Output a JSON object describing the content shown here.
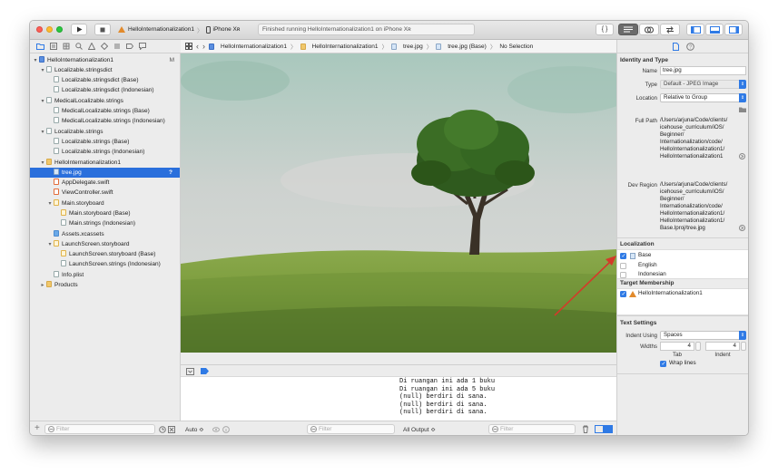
{
  "toolbar": {
    "scheme": "HelloInternationalization1",
    "device": "iPhone Xʀ",
    "status": "Finished running HelloInternationalization1 on iPhone Xʀ",
    "code_snippet_label": "{ }"
  },
  "navigator": {
    "items": [
      {
        "label": "HelloInternationalization1",
        "badge": "M"
      },
      {
        "label": "Localizable.stringsdict"
      },
      {
        "label": "Localizable.stringsdict (Base)"
      },
      {
        "label": "Localizable.stringsdict (Indonesian)"
      },
      {
        "label": "MedicalLocalizable.strings"
      },
      {
        "label": "MedicalLocalizable.strings (Base)"
      },
      {
        "label": "MedicalLocalizable.strings (Indonesian)"
      },
      {
        "label": "Localizable.strings"
      },
      {
        "label": "Localizable.strings (Base)"
      },
      {
        "label": "Localizable.strings (Indonesian)"
      },
      {
        "label": "HelloInternationalization1"
      },
      {
        "label": "tree.jpg",
        "badge": "?"
      },
      {
        "label": "AppDelegate.swift"
      },
      {
        "label": "ViewController.swift"
      },
      {
        "label": "Main.storyboard"
      },
      {
        "label": "Main.storyboard (Base)"
      },
      {
        "label": "Main.strings (Indonesian)"
      },
      {
        "label": "Assets.xcassets"
      },
      {
        "label": "LaunchScreen.storyboard"
      },
      {
        "label": "LaunchScreen.storyboard (Base)"
      },
      {
        "label": "LaunchScreen.strings (Indonesian)"
      },
      {
        "label": "Info.plist"
      },
      {
        "label": "Products"
      }
    ],
    "filter_placeholder": "Filter"
  },
  "jumpbar": {
    "crumbs": [
      "HelloInternationalization1",
      "HelloInternationalization1",
      "tree.jpg",
      "tree.jpg (Base)",
      "No Selection"
    ]
  },
  "console": {
    "lines": [
      "Di ruangan ini ada 1 buku",
      "Di ruangan ini ada 5 buku",
      "(null) berdiri di sana.",
      "(null) berdiri di sana.",
      "(null) berdiri di sana."
    ],
    "auto_label": "Auto ≎",
    "filter_placeholder": "Filter",
    "output_label": "All Output ≎",
    "filter2_placeholder": "Filter"
  },
  "inspector": {
    "identity_title": "Identity and Type",
    "name_label": "Name",
    "name_value": "tree.jpg",
    "type_label": "Type",
    "type_value": "Default - JPEG Image",
    "location_label": "Location",
    "location_value": "Relative to Group",
    "fullpath_label": "Full Path",
    "fullpath_lines": [
      "/Users/arjuna/Code/clients/",
      "icehouse_curriculum/iOS/",
      "Beginner/",
      "Internationalization/code/",
      "HelloInternationalization1/",
      "HelloInternationalization1"
    ],
    "devregion_label": "Dev Region",
    "devregion_lines": [
      "/Users/arjuna/Code/clients/",
      "icehouse_curriculum/iOS/",
      "Beginner/",
      "Internationalization/code/",
      "HelloInternationalization1/",
      "HelloInternationalization1/",
      "Base.lproj/tree.jpg"
    ],
    "localization_title": "Localization",
    "localizations": [
      {
        "label": "Base",
        "checked": true
      },
      {
        "label": "English",
        "checked": false
      },
      {
        "label": "Indonesian",
        "checked": false
      }
    ],
    "target_title": "Target Membership",
    "target": {
      "label": "HelloInternationalization1",
      "checked": true
    },
    "text_title": "Text Settings",
    "indent_label": "Indent Using",
    "indent_value": "Spaces",
    "widths_label": "Widths",
    "tab_value": "4",
    "indent_width_value": "4",
    "tab_label": "Tab",
    "indent_sub_label": "Indent",
    "wrap_label": "Wrap lines"
  },
  "colors": {
    "selection": "#2a6fdc",
    "accent": "#2f7ae5",
    "arrow": "#d23b2a"
  }
}
